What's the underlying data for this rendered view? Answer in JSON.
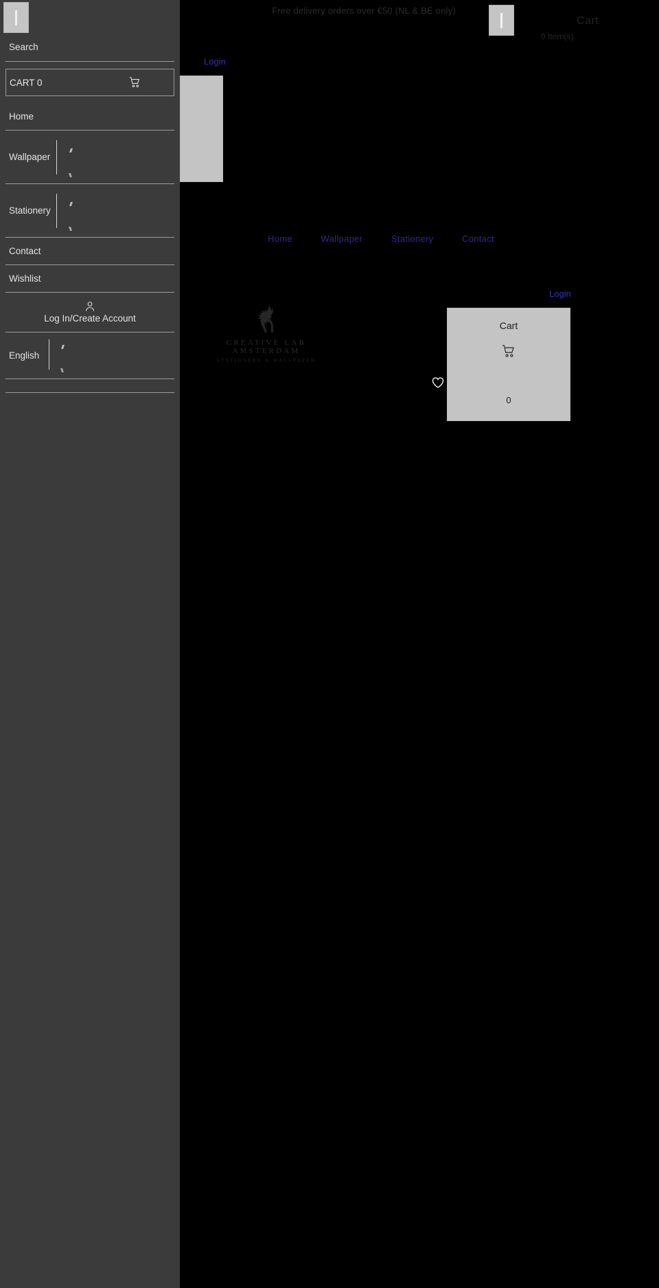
{
  "promo": {
    "text": "Free delivery orders over €50 (NL & BE only)"
  },
  "header": {
    "menu_toggle_name": "menu-toggle",
    "cart_label": "Cart",
    "cart_items_text": "0 Item(s)",
    "login_label": "Login"
  },
  "nav": {
    "items": [
      {
        "label": "Home"
      },
      {
        "label": "Wallpaper"
      },
      {
        "label": "Stationery"
      },
      {
        "label": "Contact"
      }
    ],
    "login_label": "Login"
  },
  "logo": {
    "name": "CREATIVE LAB AMSTERDAM",
    "tagline": "STATIONERY & WALLPAPER"
  },
  "cart_panel": {
    "title": "Cart",
    "count": "0",
    "icon": "shopping-cart-icon"
  },
  "wishlist": {
    "icon": "heart-icon"
  },
  "sidebar": {
    "close_label": "",
    "search_label": "Search",
    "cart_label": "CART 0",
    "cart_icon": "shopping-cart-icon",
    "items": [
      {
        "label": "Home",
        "type": "plain"
      },
      {
        "label": "Wallpaper",
        "type": "expandable"
      },
      {
        "label": "Stationery",
        "type": "expandable"
      },
      {
        "label": "Contact",
        "type": "plain"
      },
      {
        "label": "Wishlist",
        "type": "plain"
      }
    ],
    "account_label": "Log In/Create Account",
    "account_icon": "user-icon",
    "language_label": "English"
  },
  "colors": {
    "sidebar_bg": "#3b3b3b",
    "page_bg": "#000000",
    "panel_grey": "#c4c4c4",
    "link_blue": "#2f2fb8",
    "divider": "#9a9a9a"
  }
}
